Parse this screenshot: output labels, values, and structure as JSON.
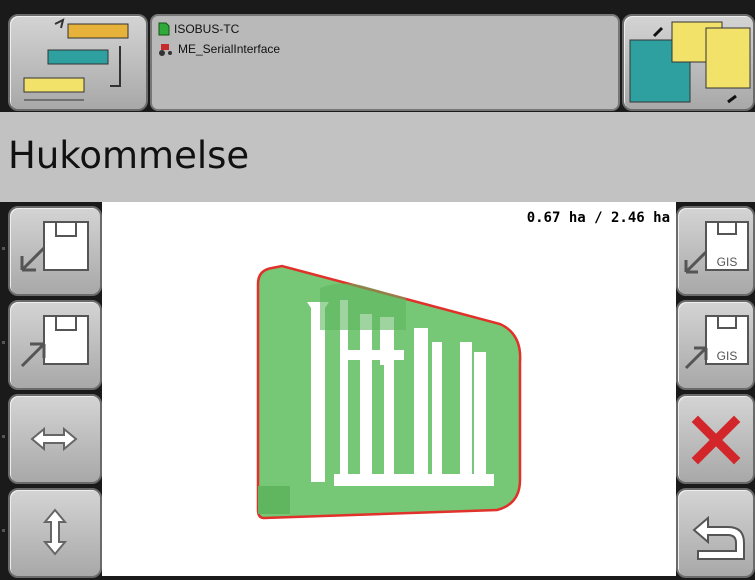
{
  "header": {
    "status_lines": [
      {
        "icon": "document-icon",
        "text": "ISOBUS-TC"
      },
      {
        "icon": "tractor-icon",
        "text": "ME_SerialInterface"
      }
    ]
  },
  "page_title": "Hukommelse",
  "map": {
    "area_display": "0.67 ha / 2.46 ha",
    "field_boundary_color": "#e0312a",
    "coverage_color": "#76c776"
  },
  "softkeys": {
    "left": [
      {
        "icon": "load-from-disk-icon"
      },
      {
        "icon": "save-to-disk-icon"
      },
      {
        "icon": "horizontal-arrows-icon"
      },
      {
        "icon": "vertical-arrows-icon"
      }
    ],
    "right": [
      {
        "icon": "load-gis-icon",
        "text": "GIS"
      },
      {
        "icon": "save-gis-icon",
        "text": "GIS"
      },
      {
        "icon": "delete-x-icon"
      },
      {
        "icon": "return-icon"
      }
    ]
  }
}
